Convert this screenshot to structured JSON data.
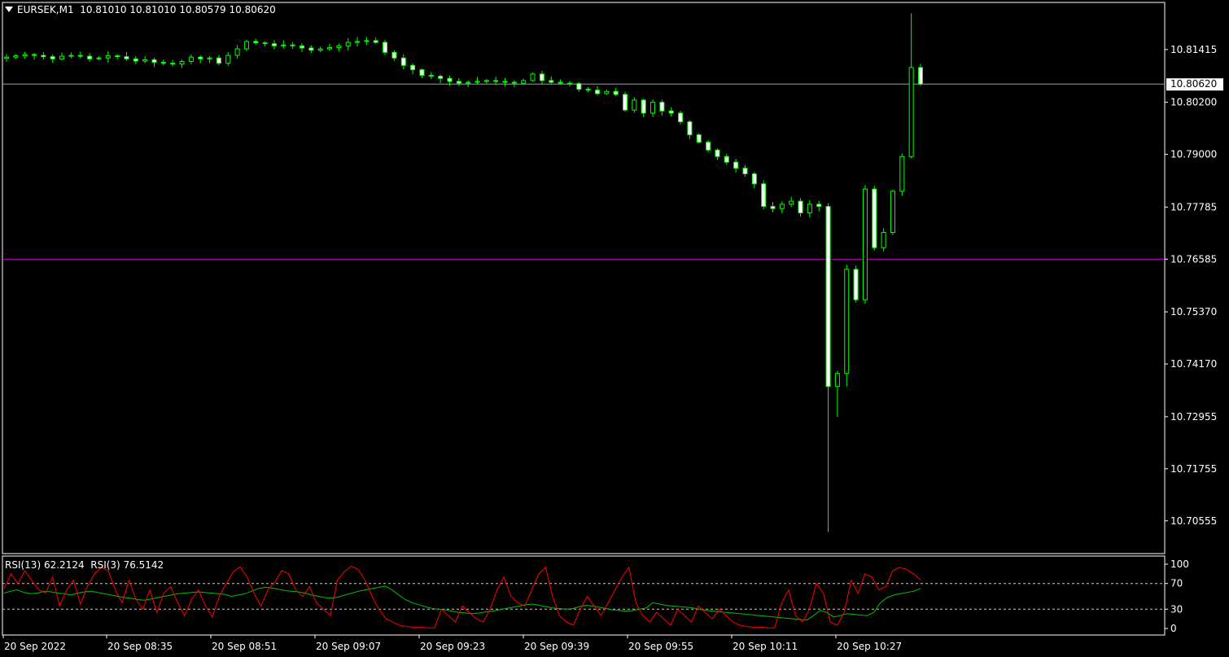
{
  "header": {
    "symbol": "EURSEK,M1",
    "open": "10.81010",
    "high": "10.81010",
    "low": "10.80579",
    "close": "10.80620"
  },
  "rsi_header": {
    "rsi13_label": "RSI(13)",
    "rsi13_value": "62.2124",
    "rsi3_label": "RSI(3)",
    "rsi3_value": "76.5142"
  },
  "colors": {
    "background": "#000000",
    "frame": "#ffffff",
    "bull_candle": "#000000",
    "bear_candle": "#ffffff",
    "wick": "#00ff00",
    "bid_line": "#9a9ab8",
    "level_line": "#c000c0",
    "rsi13": "#00c000",
    "rsi3": "#ff0000",
    "rsi_levels": "#c8c8c8"
  },
  "chart_data": [
    {
      "type": "candlestick",
      "symbol": "EURSEK",
      "timeframe": "M1",
      "ylim": [
        10.698,
        10.825
      ],
      "yticks": [
        "10.81415",
        "10.80200",
        "10.79000",
        "10.77785",
        "10.76585",
        "10.75370",
        "10.74170",
        "10.72955",
        "10.71755",
        "10.70555"
      ],
      "current_price": "10.80620",
      "horizontal_level": 10.7658,
      "xticks": [
        "20 Sep 2022",
        "20 Sep 08:35",
        "20 Sep 08:51",
        "20 Sep 09:07",
        "20 Sep 09:23",
        "20 Sep 09:39",
        "20 Sep 09:55",
        "20 Sep 10:11",
        "20 Sep 10:27"
      ],
      "close_path": [
        10.8124,
        10.8127,
        10.813,
        10.8128,
        10.8125,
        10.812,
        10.8126,
        10.8128,
        10.8126,
        10.812,
        10.8122,
        10.8127,
        10.8125,
        10.812,
        10.8115,
        10.8118,
        10.8112,
        10.811,
        10.8108,
        10.8114,
        10.8124,
        10.812,
        10.8122,
        10.811,
        10.8128,
        10.8143,
        10.816,
        10.8157,
        10.8155,
        10.815,
        10.8152,
        10.815,
        10.8145,
        10.814,
        10.8143,
        10.8146,
        10.815,
        10.8158,
        10.816,
        10.8162,
        10.8158,
        10.8135,
        10.8122,
        10.8105,
        10.8095,
        10.8082,
        10.808,
        10.8075,
        10.8068,
        10.8064,
        10.8066,
        10.8068,
        10.807,
        10.8068,
        10.8066,
        10.8064,
        10.807,
        10.8085,
        10.807,
        10.8066,
        10.8064,
        10.8063,
        10.805,
        10.8048,
        10.804,
        10.8045,
        10.8038,
        10.8002,
        10.8025,
        10.7995,
        10.802,
        10.8,
        10.7995,
        10.7975,
        10.7945,
        10.7928,
        10.791,
        10.7895,
        10.7882,
        10.7868,
        10.7855,
        10.7832,
        10.778,
        10.7775,
        10.7785,
        10.7792,
        10.7765,
        10.7785,
        10.778,
        10.7365,
        10.7395,
        10.7635,
        10.7565,
        10.782,
        10.7685,
        10.772,
        10.7815,
        10.7895,
        10.81,
        10.8062
      ],
      "low_extreme": 10.703,
      "high_extreme": 10.8225
    },
    {
      "type": "line",
      "indicator": "RSI",
      "ylim": [
        0,
        100
      ],
      "yticks": [
        100,
        70,
        30,
        0
      ],
      "levels": [
        70,
        30
      ],
      "series": [
        {
          "name": "RSI(13)",
          "color": "#00c000",
          "last_value": 62.2124,
          "values": [
            55,
            58,
            60,
            56,
            54,
            55,
            58,
            57,
            55,
            54,
            52,
            55,
            57,
            58,
            56,
            54,
            52,
            50,
            48,
            47,
            45,
            44,
            46,
            48,
            50,
            52,
            54,
            55,
            56,
            57,
            56,
            55,
            54,
            53,
            50,
            52,
            54,
            58,
            62,
            64,
            63,
            61,
            59,
            58,
            57,
            55,
            52,
            50,
            48,
            47,
            49,
            52,
            55,
            58,
            60,
            62,
            64,
            66,
            60,
            52,
            45,
            40,
            37,
            34,
            31,
            30,
            29,
            27,
            25,
            24,
            23,
            24,
            26,
            27,
            29,
            31,
            33,
            35,
            37,
            38,
            36,
            34,
            32,
            31,
            30,
            31,
            34,
            36,
            35,
            33,
            31,
            29,
            28,
            27,
            28,
            30,
            32,
            40,
            38,
            36,
            35,
            34,
            33,
            32,
            30,
            28,
            27,
            26,
            25,
            24,
            23,
            22,
            21,
            20,
            19,
            18,
            17,
            16,
            15,
            14,
            13,
            20,
            28,
            25,
            18,
            20,
            23,
            22,
            21,
            20,
            25,
            40,
            48,
            52,
            54,
            56,
            58,
            62
          ]
        },
        {
          "name": "RSI(3)",
          "color": "#ff0000",
          "last_value": 76.5142,
          "values": [
            62,
            85,
            70,
            90,
            75,
            60,
            55,
            80,
            35,
            60,
            75,
            38,
            65,
            85,
            95,
            90,
            60,
            40,
            75,
            45,
            30,
            60,
            25,
            55,
            65,
            40,
            20,
            45,
            60,
            35,
            18,
            50,
            70,
            88,
            96,
            80,
            55,
            35,
            60,
            72,
            90,
            85,
            60,
            50,
            65,
            40,
            30,
            20,
            75,
            88,
            97,
            92,
            75,
            50,
            30,
            15,
            10,
            5,
            3,
            2,
            2,
            1,
            1,
            30,
            20,
            10,
            35,
            25,
            15,
            10,
            30,
            60,
            80,
            50,
            40,
            35,
            60,
            85,
            95,
            50,
            20,
            10,
            5,
            30,
            50,
            35,
            20,
            40,
            60,
            80,
            95,
            40,
            20,
            10,
            25,
            15,
            5,
            30,
            20,
            10,
            35,
            25,
            15,
            30,
            20,
            10,
            5,
            3,
            2,
            2,
            1,
            1,
            40,
            60,
            20,
            10,
            30,
            70,
            55,
            10,
            5,
            25,
            75,
            55,
            85,
            80,
            60,
            65,
            90,
            95,
            92,
            85,
            76
          ]
        }
      ]
    }
  ]
}
